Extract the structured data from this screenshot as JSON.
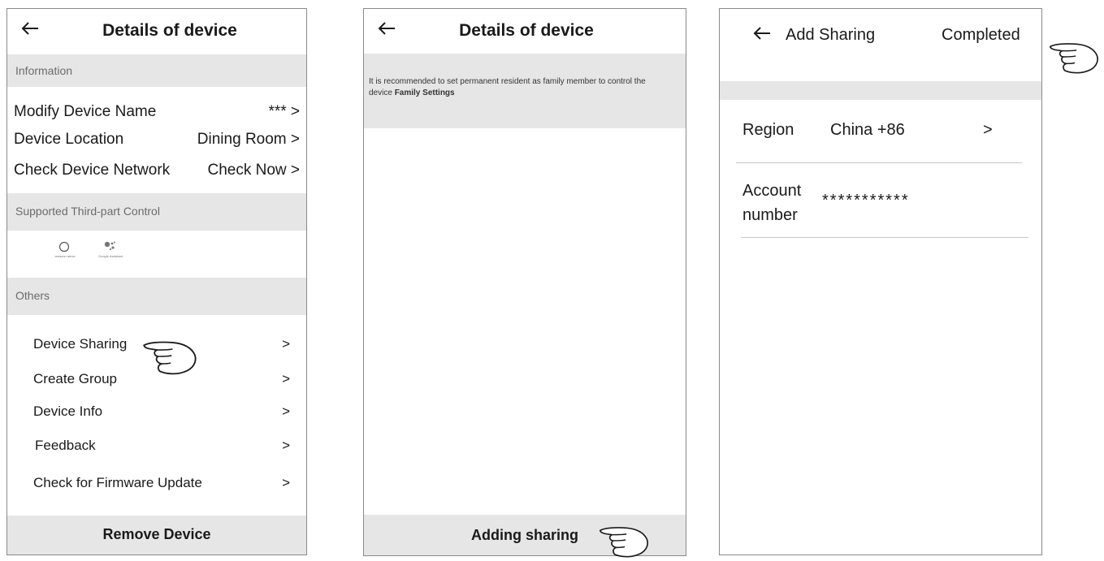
{
  "screen1": {
    "title": "Details of device",
    "info_section": "Information",
    "info_rows": [
      {
        "label": "Modify Device Name",
        "value": "*** >"
      },
      {
        "label": "Device Location",
        "value": "Dining Room >"
      },
      {
        "label": "Check Device Network",
        "value": "Check Now >"
      }
    ],
    "third_party_section": "Supported Third-part Control",
    "alexa_label": "amazon alexa",
    "google_label": "Google Assistant",
    "others_section": "Others",
    "other_rows": [
      {
        "label": "Device Sharing",
        "chevron": ">"
      },
      {
        "label": "Create Group",
        "chevron": ">"
      },
      {
        "label": "Device Info",
        "chevron": ">"
      },
      {
        "label": "Feedback",
        "chevron": ">"
      },
      {
        "label": "Check for Firmware Update",
        "chevron": ">"
      }
    ],
    "remove_label": "Remove Device"
  },
  "screen2": {
    "title": "Details of device",
    "notice_text": "It is recommended to set permanent resident as family member to control the device ",
    "notice_link": "Family Settings",
    "adding_label": "Adding sharing"
  },
  "screen3": {
    "title": "Add Sharing",
    "completed_label": "Completed",
    "region_label": "Region",
    "region_value": "China +86",
    "region_chevron": ">",
    "account_label": "Account number",
    "account_value": "***********"
  },
  "icons": {
    "back": "back-arrow-icon",
    "pointer": "pointing-hand-icon",
    "alexa": "alexa-ring-icon",
    "google": "google-assistant-icon"
  }
}
